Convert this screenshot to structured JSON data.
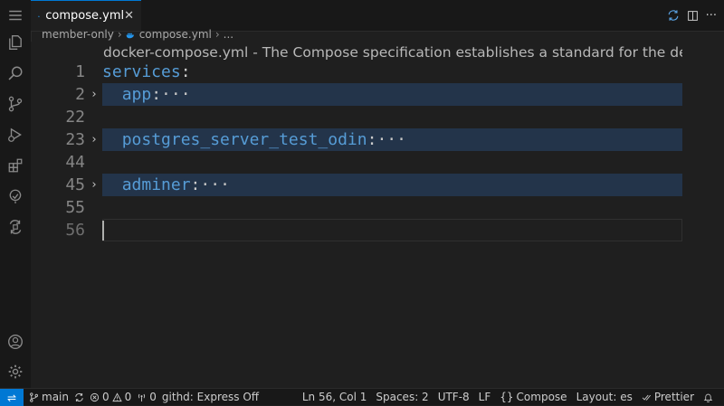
{
  "tab": {
    "title": "compose.yml",
    "close": "✕",
    "icon": "docker-whale-icon"
  },
  "tab_actions": {
    "sync_icon": "sync-icon",
    "split_icon": "split-editor-icon",
    "more": "···"
  },
  "breadcrumb": {
    "folder": "member-only",
    "file": "compose.yml",
    "more": "...",
    "sep": "›"
  },
  "hover_doc": "docker-compose.yml - The Compose specification establishes a standard for the defi…",
  "editor": {
    "lines": [
      {
        "num": "1",
        "key": "services",
        "indent": "",
        "folded": false
      },
      {
        "num": "2",
        "key": "app",
        "indent": "  ",
        "folded": true
      },
      {
        "num": "22",
        "key": "",
        "indent": "",
        "folded": false
      },
      {
        "num": "23",
        "key": "postgres_server_test_odin",
        "indent": "  ",
        "folded": true
      },
      {
        "num": "44",
        "key": "",
        "indent": "",
        "folded": false
      },
      {
        "num": "45",
        "key": "adminer",
        "indent": "  ",
        "folded": true
      },
      {
        "num": "55",
        "key": "",
        "indent": "",
        "folded": false
      },
      {
        "num": "56",
        "key": "",
        "indent": "",
        "folded": false
      }
    ],
    "colon": ":",
    "ellipsis": "···",
    "fold_glyph": "›"
  },
  "status": {
    "remote_glyph": "⇌",
    "branch": "main",
    "errors": "0",
    "warnings": "0",
    "ports": "0",
    "githd": "githd: Express Off",
    "position": "Ln 56, Col 1",
    "spaces": "Spaces: 2",
    "encoding": "UTF-8",
    "eol": "LF",
    "language": "Compose",
    "language_prefix": "{}",
    "layout": "Layout: es",
    "prettier": "Prettier"
  },
  "colors": {
    "accent": "#0078d4",
    "key": "#569cd6",
    "fold_highlight": "#23344a"
  }
}
